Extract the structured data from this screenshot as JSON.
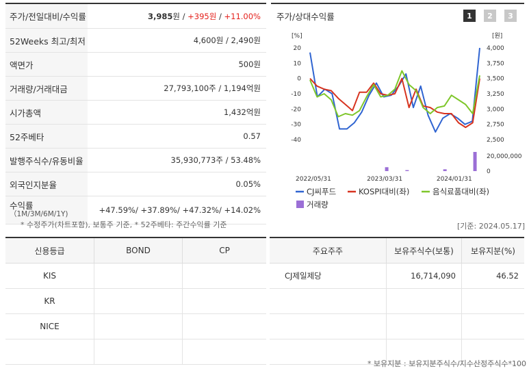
{
  "summary": {
    "rows": [
      {
        "label": "주가/전일대비/수익률",
        "price": "3,985",
        "won": "원",
        "sep1": " / ",
        "change": "+395원",
        "sep2": " / ",
        "rate": "+11.00%"
      },
      {
        "label": "52Weeks 최고/최저",
        "value": "4,600원 / 2,490원"
      },
      {
        "label": "액면가",
        "value": "500원"
      },
      {
        "label": "거래량/거래대금",
        "value": "27,793,100주 / 1,194억원"
      },
      {
        "label": "시가총액",
        "value": "1,432억원"
      },
      {
        "label": "52주베타",
        "value": "0.57"
      },
      {
        "label": "발행주식수/유동비율",
        "value": "35,930,773주 / 53.48%"
      },
      {
        "label": "외국인지분율",
        "value": "0.05%"
      }
    ],
    "returns": {
      "label": "수익률",
      "sub": "（1M/3M/6M/1Y)",
      "value": "+47.59%/ +37.89%/ +47.32%/ +14.02%"
    },
    "note": "* 수정주가(차트포함), 보통주 기준, * 52주베타: 주간수익률 기준"
  },
  "chart_panel": {
    "title": "주가/상대수익률",
    "pages": [
      "1",
      "2",
      "3"
    ],
    "base_date": "[기준: 2024.05.17]"
  },
  "chart_data": {
    "type": "line",
    "left_axis_unit": "[%]",
    "right_axis_unit": "[원]",
    "left_ticks": [
      "20",
      "10",
      "0",
      "-10",
      "-20",
      "-30",
      "-40"
    ],
    "right_ticks": [
      "4,000",
      "3,750",
      "3,500",
      "3,250",
      "3,000",
      "2,750",
      "2,500"
    ],
    "volume_ticks": [
      "20,000,000",
      "0"
    ],
    "x_labels": [
      "2022/05/31",
      "2023/03/31",
      "2024/01/31"
    ],
    "ylim_left": [
      -40,
      20
    ],
    "ylim_right": [
      2500,
      4000
    ],
    "volume_max": 20000000,
    "series": [
      {
        "name": "CJ씨푸드",
        "color": "#2f64d1",
        "values": [
          17,
          -12,
          -7,
          -10,
          -33,
          -33,
          -29,
          -22,
          -11,
          -3,
          -12,
          -11,
          -5,
          3,
          -19,
          -5,
          -24,
          -35,
          -26,
          -23,
          -26,
          -30,
          -28,
          20
        ]
      },
      {
        "name": "KOSPI대비(좌)",
        "color": "#d7331f",
        "values": [
          0,
          -5,
          -7,
          -8,
          -13,
          -17,
          -21,
          -9,
          -9,
          -3,
          -10,
          -11,
          -10,
          0,
          -19,
          -7,
          -18,
          -19,
          -22,
          -23,
          -23,
          -29,
          -32,
          -29,
          0
        ]
      },
      {
        "name": "음식료품대비(좌)",
        "color": "#7ec62a",
        "values": [
          -1,
          -12,
          -10,
          -14,
          -25,
          -23,
          -24,
          -21,
          -12,
          -4,
          -12,
          -11,
          -7,
          5,
          -4,
          -8,
          -19,
          -23,
          -19,
          -18,
          -11,
          -14,
          -17,
          -23,
          2
        ]
      }
    ],
    "volume": {
      "name": "거래량",
      "color": "#9b6fd6",
      "bars": [
        {
          "pos": 0.452,
          "value": 5200000
        },
        {
          "pos": 0.572,
          "value": 1300000
        },
        {
          "pos": 0.795,
          "value": 2400000
        },
        {
          "pos": 0.972,
          "value": 27793100
        }
      ]
    }
  },
  "credit": {
    "headers": [
      "신용등급",
      "BOND",
      "CP"
    ],
    "rows": [
      [
        "KIS",
        "",
        ""
      ],
      [
        "KR",
        "",
        ""
      ],
      [
        "NICE",
        "",
        ""
      ],
      [
        "",
        "",
        ""
      ]
    ]
  },
  "holders": {
    "headers": [
      "주요주주",
      "보유주식수(보통)",
      "보유지분(%)"
    ],
    "rows": [
      [
        "CJ제일제당",
        "16,714,090",
        "46.52"
      ],
      [
        "",
        "",
        ""
      ],
      [
        "",
        "",
        ""
      ],
      [
        "",
        "",
        ""
      ]
    ],
    "note": "* 보유지분 : 보유지분주식수/지수산정주식수*100"
  }
}
